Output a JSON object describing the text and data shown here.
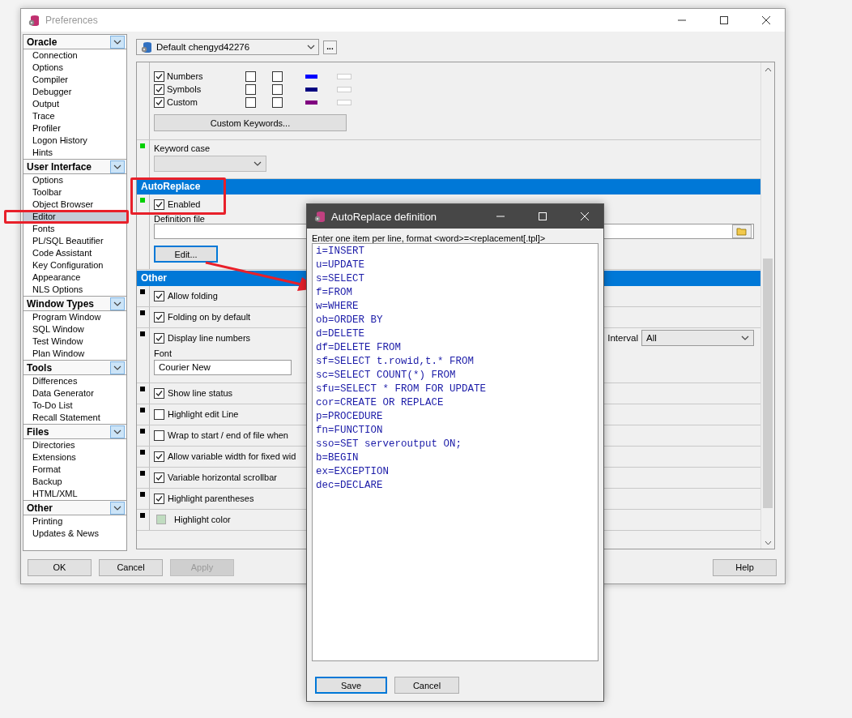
{
  "window": {
    "title": "Preferences"
  },
  "sidebar": {
    "groups": [
      {
        "title": "Oracle",
        "items": [
          {
            "label": "Connection",
            "selected": false
          },
          {
            "label": "Options",
            "selected": false
          },
          {
            "label": "Compiler",
            "selected": false
          },
          {
            "label": "Debugger",
            "selected": false
          },
          {
            "label": "Output",
            "selected": false
          },
          {
            "label": "Trace",
            "selected": false
          },
          {
            "label": "Profiler",
            "selected": false
          },
          {
            "label": "Logon History",
            "selected": false
          },
          {
            "label": "Hints",
            "selected": false
          }
        ]
      },
      {
        "title": "User Interface",
        "items": [
          {
            "label": "Options",
            "selected": false
          },
          {
            "label": "Toolbar",
            "selected": false
          },
          {
            "label": "Object Browser",
            "selected": false
          },
          {
            "label": "Editor",
            "selected": true
          },
          {
            "label": "Fonts",
            "selected": false
          },
          {
            "label": "PL/SQL Beautifier",
            "selected": false
          },
          {
            "label": "Code Assistant",
            "selected": false
          },
          {
            "label": "Key Configuration",
            "selected": false
          },
          {
            "label": "Appearance",
            "selected": false
          },
          {
            "label": "NLS Options",
            "selected": false
          }
        ]
      },
      {
        "title": "Window Types",
        "items": [
          {
            "label": "Program Window",
            "selected": false
          },
          {
            "label": "SQL Window",
            "selected": false
          },
          {
            "label": "Test Window",
            "selected": false
          },
          {
            "label": "Plan Window",
            "selected": false
          }
        ]
      },
      {
        "title": "Tools",
        "items": [
          {
            "label": "Differences",
            "selected": false
          },
          {
            "label": "Data Generator",
            "selected": false
          },
          {
            "label": "To-Do List",
            "selected": false
          },
          {
            "label": "Recall Statement",
            "selected": false
          }
        ]
      },
      {
        "title": "Files",
        "items": [
          {
            "label": "Directories",
            "selected": false
          },
          {
            "label": "Extensions",
            "selected": false
          },
          {
            "label": "Format",
            "selected": false
          },
          {
            "label": "Backup",
            "selected": false
          },
          {
            "label": "HTML/XML",
            "selected": false
          }
        ]
      },
      {
        "title": "Other",
        "items": [
          {
            "label": "Printing",
            "selected": false
          },
          {
            "label": "Updates & News",
            "selected": false
          }
        ]
      }
    ]
  },
  "profile": {
    "value": "Default chengyd42276",
    "more_button": "..."
  },
  "syntax_rows": [
    {
      "label": "Numbers",
      "checked": true,
      "extra_checks": [
        false,
        false
      ],
      "color": "#0000ff"
    },
    {
      "label": "Symbols",
      "checked": true,
      "extra_checks": [
        false,
        false
      ],
      "color": "#000080"
    },
    {
      "label": "Custom",
      "checked": true,
      "extra_checks": [
        false,
        false
      ],
      "color": "#800080"
    }
  ],
  "custom_keywords_button": "Custom Keywords...",
  "keyword_case": {
    "label": "Keyword case",
    "disabled": true
  },
  "autoreplace": {
    "title": "AutoReplace",
    "enabled": {
      "label": "Enabled",
      "checked": true
    },
    "definition_file_label": "Definition file",
    "edit_button": "Edit..."
  },
  "other": {
    "title": "Other",
    "options": [
      {
        "kind": "checkbox",
        "label": "Allow folding",
        "checked": true
      },
      {
        "kind": "checkbox",
        "label": "Folding on by default",
        "checked": true
      },
      {
        "kind": "line_numbers",
        "label": "Display line numbers",
        "checked": true,
        "font_label": "Font",
        "font_value": "Courier New",
        "interval_label": "Interval",
        "interval_value": "All"
      },
      {
        "kind": "checkbox",
        "label": "Show line status",
        "checked": true
      },
      {
        "kind": "checkbox",
        "label": "Highlight edit Line",
        "checked": false
      },
      {
        "kind": "checkbox",
        "label": "Wrap to start / end of file when",
        "checked": false
      },
      {
        "kind": "checkbox",
        "label": "Allow variable width for fixed wid",
        "checked": true
      },
      {
        "kind": "checkbox",
        "label": "Variable horizontal scrollbar",
        "checked": true
      },
      {
        "kind": "checkbox",
        "label": "Highlight parentheses",
        "checked": true
      },
      {
        "kind": "color",
        "label": "Highlight color",
        "color": "#c0dcc0"
      }
    ]
  },
  "buttons": [
    {
      "label": "OK",
      "disabled": false
    },
    {
      "label": "Cancel",
      "disabled": false
    },
    {
      "label": "Apply",
      "disabled": true
    },
    {
      "label": "Help",
      "disabled": false
    }
  ],
  "dialog": {
    "title": "AutoReplace definition",
    "instruction": "Enter one item per line, format <word>=<replacement[.tpl]>",
    "lines": [
      "i=INSERT",
      "u=UPDATE",
      "s=SELECT",
      "f=FROM",
      "w=WHERE",
      "ob=ORDER BY",
      "d=DELETE",
      "df=DELETE FROM",
      "sf=SELECT t.rowid,t.* FROM",
      "sc=SELECT COUNT(*) FROM",
      "sfu=SELECT * FROM FOR UPDATE",
      "cor=CREATE OR REPLACE",
      "p=PROCEDURE",
      "fn=FUNCTION",
      "sso=SET serveroutput ON;",
      "b=BEGIN",
      "ex=EXCEPTION",
      "dec=DECLARE"
    ],
    "buttons": [
      {
        "label": "Save",
        "focused": true
      },
      {
        "label": "Cancel",
        "focused": false
      }
    ]
  }
}
